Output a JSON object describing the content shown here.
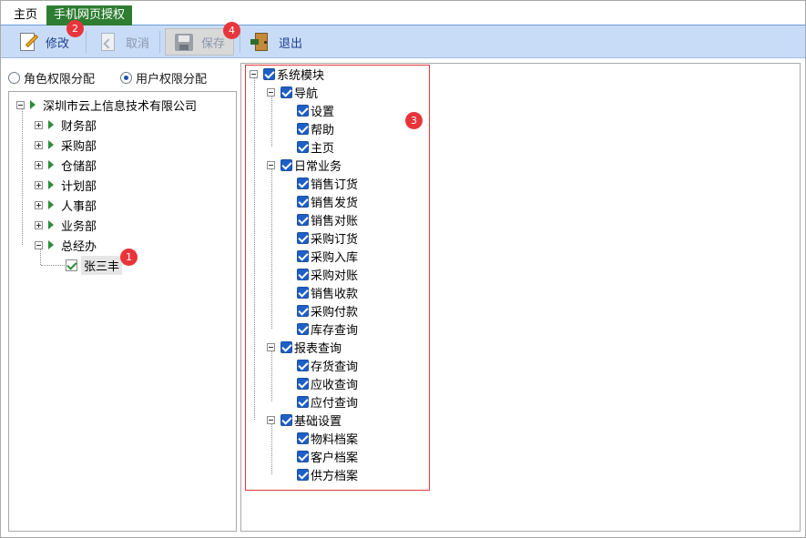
{
  "tabs": {
    "home": "主页",
    "active": "手机网页授权"
  },
  "toolbar": {
    "edit_label": "修改",
    "cancel_label": "取消",
    "save_label": "保存",
    "exit_label": "退出"
  },
  "badges": {
    "b1": "1",
    "b2": "2",
    "b3": "3",
    "b4": "4"
  },
  "radios": {
    "role_label": "角色权限分配",
    "user_label": "用户权限分配",
    "selected": "user"
  },
  "org_tree": {
    "root": "深圳市云上信息技术有限公司",
    "departments": [
      "财务部",
      "采购部",
      "仓储部",
      "计划部",
      "人事部",
      "业务部",
      "总经办"
    ],
    "selected_user": "张三丰"
  },
  "module_tree": {
    "root": "系统模块",
    "groups": [
      {
        "label": "导航",
        "items": [
          "设置",
          "帮助",
          "主页"
        ]
      },
      {
        "label": "日常业务",
        "items": [
          "销售订货",
          "销售发货",
          "销售对账",
          "采购订货",
          "采购入库",
          "采购对账",
          "销售收款",
          "采购付款",
          "库存查询"
        ]
      },
      {
        "label": "报表查询",
        "items": [
          "存货查询",
          "应收查询",
          "应付查询"
        ]
      },
      {
        "label": "基础设置",
        "items": [
          "物料档案",
          "客户档案",
          "供方档案"
        ]
      }
    ]
  },
  "colors": {
    "accent_tab": "#2e7d32",
    "toolbar_bg": "#c9dcf7",
    "checkbox": "#1e5fc8",
    "badge": "#e8353b",
    "highlight_box": "#e03a3a"
  }
}
